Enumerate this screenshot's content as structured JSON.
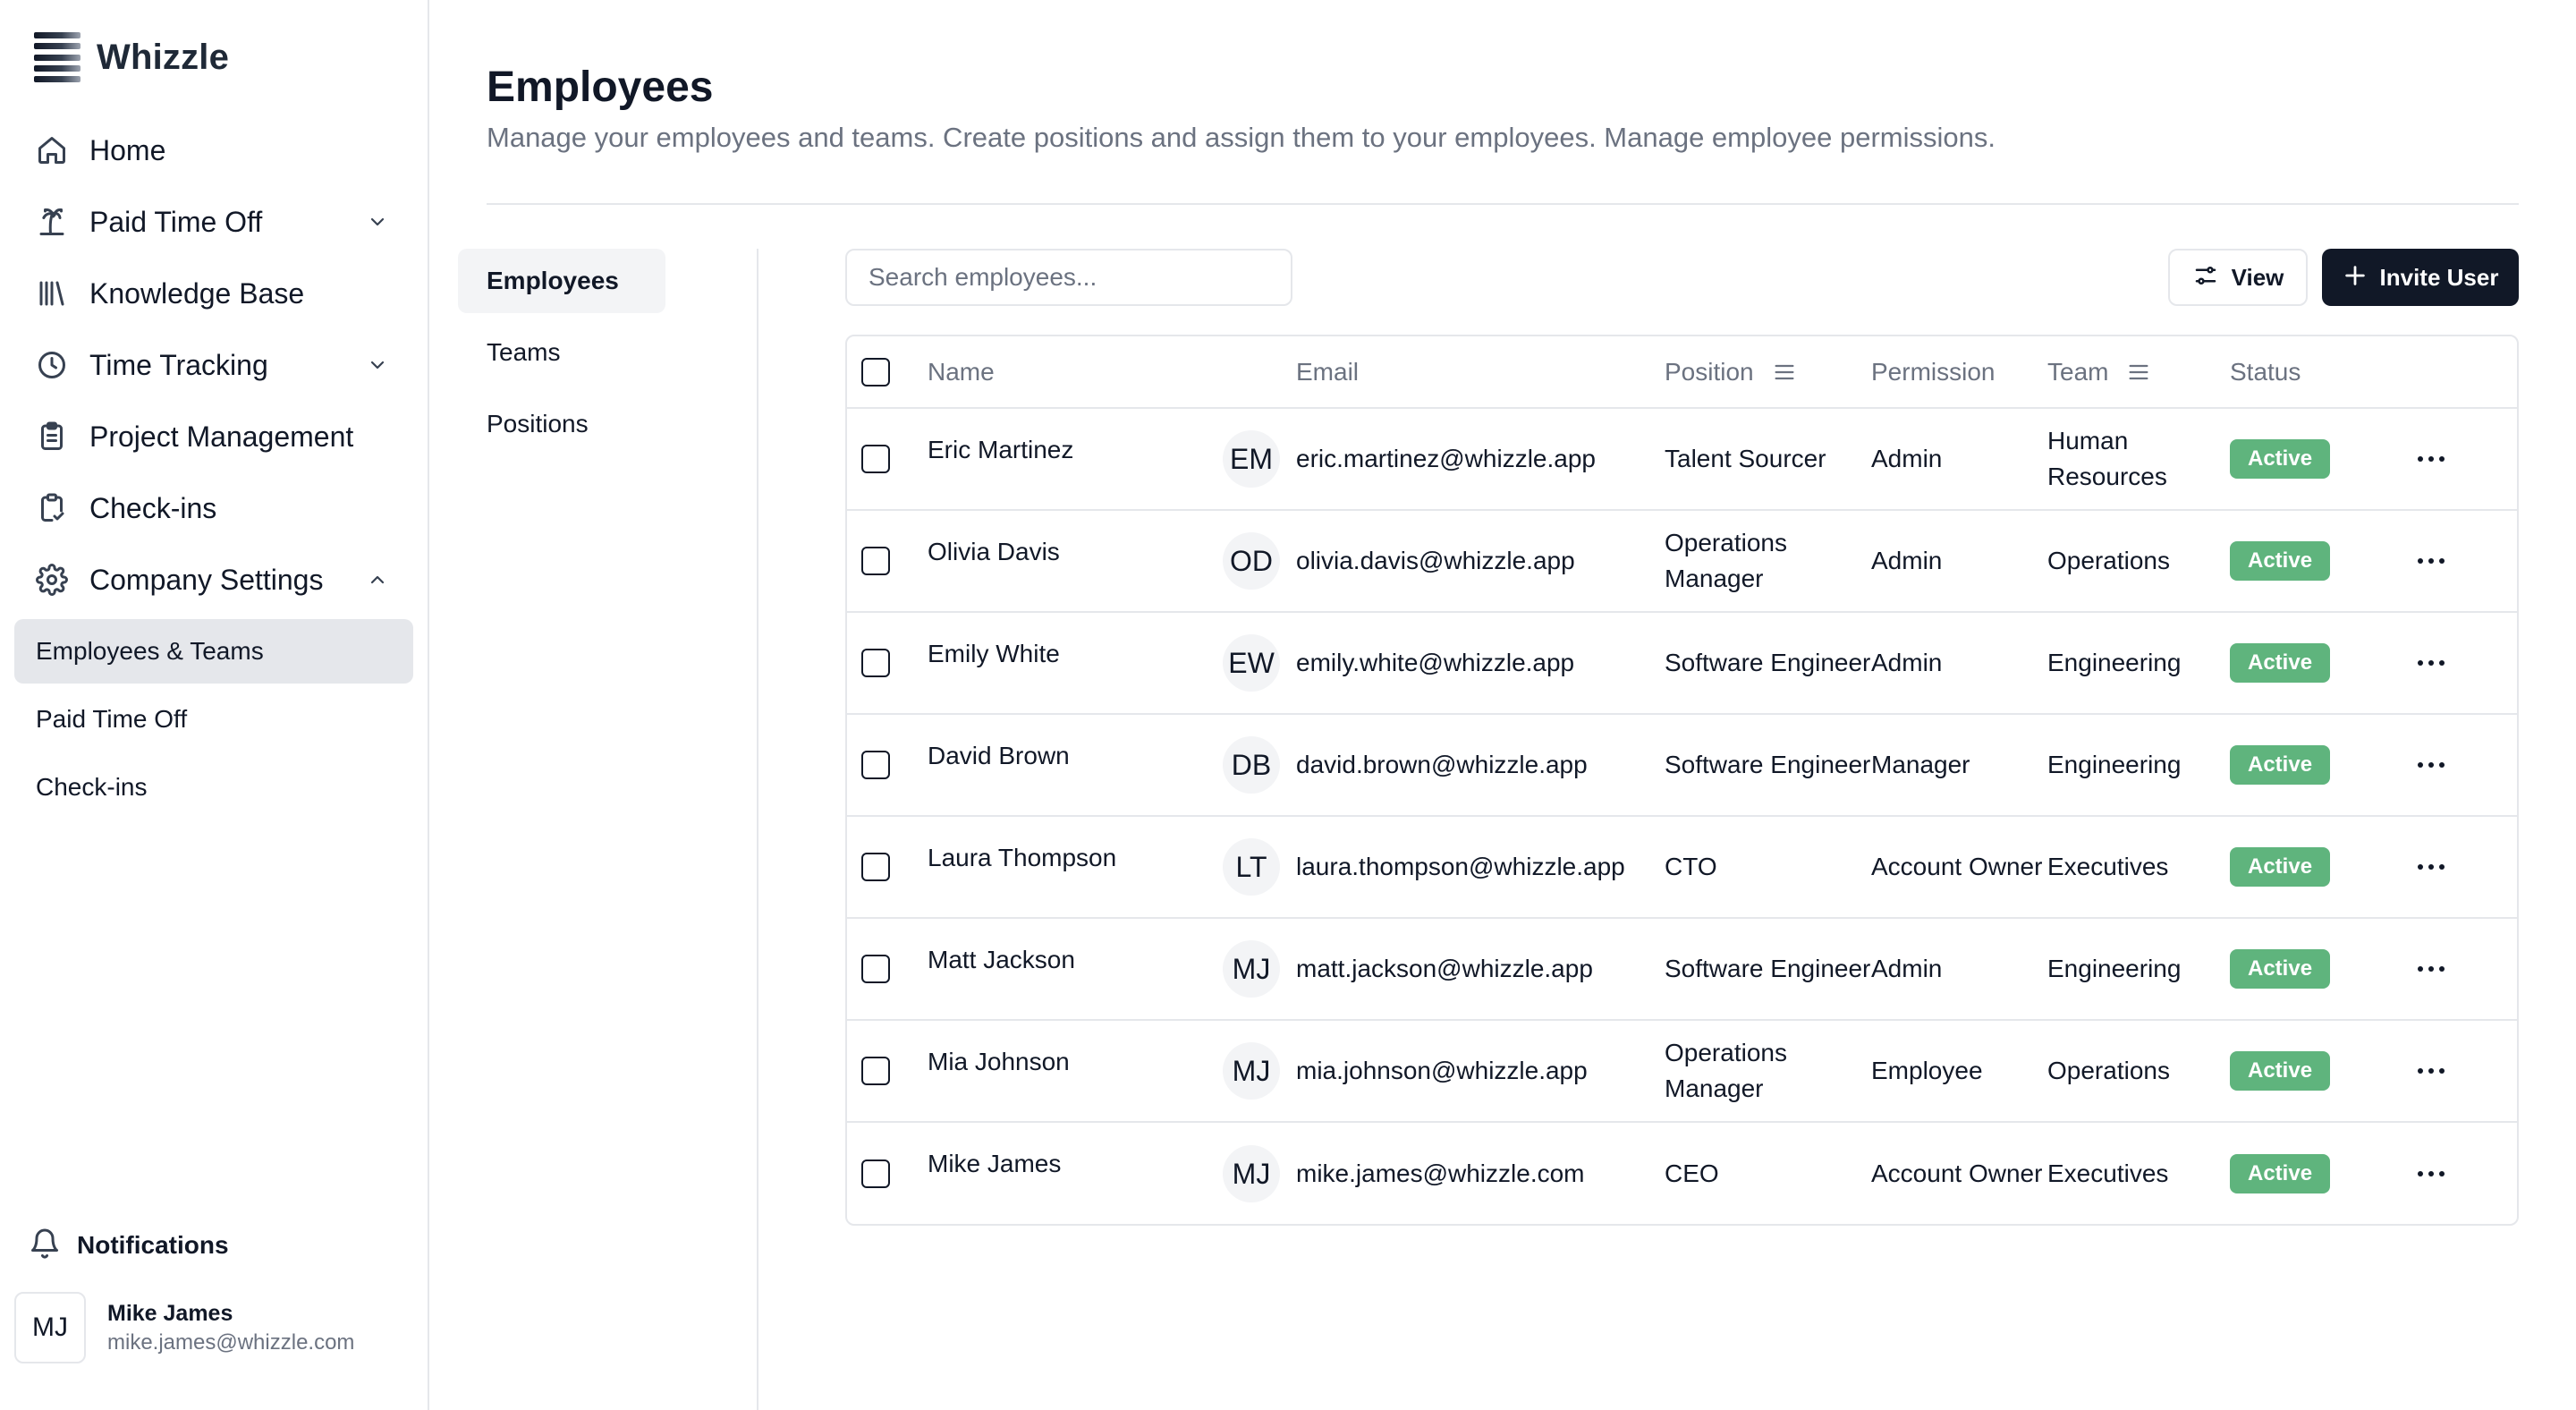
{
  "app": {
    "name": "Whizzle"
  },
  "sidebar": {
    "items": [
      {
        "label": "Home",
        "icon": "home-icon",
        "has_chevron": false
      },
      {
        "label": "Paid Time Off",
        "icon": "palm-tree-icon",
        "has_chevron": true,
        "expanded": false
      },
      {
        "label": "Knowledge Base",
        "icon": "library-icon",
        "has_chevron": false
      },
      {
        "label": "Time Tracking",
        "icon": "clock-icon",
        "has_chevron": true,
        "expanded": false
      },
      {
        "label": "Project Management",
        "icon": "clipboard-icon",
        "has_chevron": false
      },
      {
        "label": "Check-ins",
        "icon": "clipboard-check-icon",
        "has_chevron": false
      },
      {
        "label": "Company Settings",
        "icon": "gear-icon",
        "has_chevron": true,
        "expanded": true
      }
    ],
    "sub_items": [
      {
        "label": "Employees & Teams",
        "active": true
      },
      {
        "label": "Paid Time Off",
        "active": false
      },
      {
        "label": "Check-ins",
        "active": false
      }
    ],
    "notifications_label": "Notifications",
    "user": {
      "initials": "MJ",
      "name": "Mike James",
      "email": "mike.james@whizzle.com"
    }
  },
  "main": {
    "title": "Employees",
    "description": "Manage your employees and teams. Create positions and assign them to your employees. Manage employee permissions.",
    "tabs": [
      {
        "label": "Employees",
        "active": true
      },
      {
        "label": "Teams",
        "active": false
      },
      {
        "label": "Positions",
        "active": false
      }
    ],
    "search": {
      "placeholder": "Search employees...",
      "value": ""
    },
    "view_button": "View",
    "invite_button": "Invite User",
    "table": {
      "columns": {
        "name": "Name",
        "email": "Email",
        "position": "Position",
        "permission": "Permission",
        "team": "Team",
        "status": "Status"
      },
      "rows": [
        {
          "name": "Eric Martinez",
          "initials": "EM",
          "email": "eric.martinez@whizzle.app",
          "position": "Talent Sourcer",
          "permission": "Admin",
          "team": "Human Resources",
          "status": "Active"
        },
        {
          "name": "Olivia Davis",
          "initials": "OD",
          "email": "olivia.davis@whizzle.app",
          "position": "Operations Manager",
          "permission": "Admin",
          "team": "Operations",
          "status": "Active"
        },
        {
          "name": "Emily White",
          "initials": "EW",
          "email": "emily.white@whizzle.app",
          "position": "Software Engineer",
          "permission": "Admin",
          "team": "Engineering",
          "status": "Active"
        },
        {
          "name": "David Brown",
          "initials": "DB",
          "email": "david.brown@whizzle.app",
          "position": "Software Engineer",
          "permission": "Manager",
          "team": "Engineering",
          "status": "Active"
        },
        {
          "name": "Laura Thompson",
          "initials": "LT",
          "email": "laura.thompson@whizzle.app",
          "position": "CTO",
          "permission": "Account Owner",
          "team": "Executives",
          "status": "Active"
        },
        {
          "name": "Matt Jackson",
          "initials": "MJ",
          "email": "matt.jackson@whizzle.app",
          "position": "Software Engineer",
          "permission": "Admin",
          "team": "Engineering",
          "status": "Active"
        },
        {
          "name": "Mia Johnson",
          "initials": "MJ",
          "email": "mia.johnson@whizzle.app",
          "position": "Operations Manager",
          "permission": "Employee",
          "team": "Operations",
          "status": "Active"
        },
        {
          "name": "Mike James",
          "initials": "MJ",
          "email": "mike.james@whizzle.com",
          "position": "CEO",
          "permission": "Account Owner",
          "team": "Executives",
          "status": "Active"
        }
      ]
    }
  },
  "colors": {
    "accent": "#111827",
    "active_badge": "#5fb47d",
    "muted_text": "#6b7280",
    "border": "#e5e7eb"
  }
}
